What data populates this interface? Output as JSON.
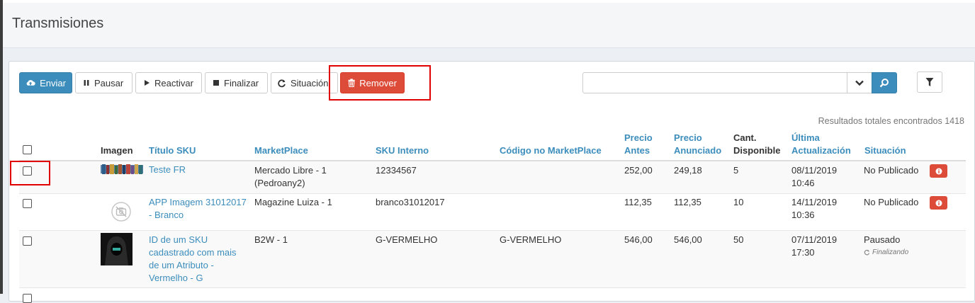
{
  "page": {
    "title": "Transmisiones"
  },
  "toolbar": {
    "enviar": "Enviar",
    "pausar": "Pausar",
    "reactivar": "Reactivar",
    "finalizar": "Finalizar",
    "situacion": "Situación",
    "remover": "Remover"
  },
  "search": {
    "value": "",
    "placeholder": ""
  },
  "results": {
    "text": "Resultados totales encontrados 1418"
  },
  "columns": {
    "imagen": "Imagen",
    "titulo": "Título SKU",
    "marketplace": "MarketPlace",
    "sku_interno": "SKU Interno",
    "codigo": "Código no MarketPlace",
    "precio_antes": [
      "Precio",
      "Antes"
    ],
    "precio_anunciado": [
      "Precio",
      "Anunciado"
    ],
    "cant": [
      "Cant.",
      "Disponible"
    ],
    "ultima": [
      "Última",
      "Actualización"
    ],
    "situacion": "Situación"
  },
  "rows": [
    {
      "titulo": [
        "Teste FR"
      ],
      "marketplace": [
        "Mercado Libre - 1",
        "(Pedroany2)"
      ],
      "sku_interno": "12334567",
      "codigo": "",
      "precio_antes": "252,00",
      "precio_anunciado": "249,18",
      "cant": "5",
      "ultima": [
        "08/11/2019",
        "10:46"
      ],
      "situacion": "No Publicado",
      "sub_status": ""
    },
    {
      "titulo": [
        "APP Imagem 31012017",
        "- Branco"
      ],
      "marketplace": [
        "Magazine Luiza - 1"
      ],
      "sku_interno": "branco31012017",
      "codigo": "",
      "precio_antes": "112,35",
      "precio_anunciado": "112,35",
      "cant": "10",
      "ultima": [
        "14/11/2019",
        "10:36"
      ],
      "situacion": "No Publicado",
      "sub_status": ""
    },
    {
      "titulo": [
        "ID de um SKU",
        "cadastrado com mais",
        "de um Atributo -",
        "Vermelho - G"
      ],
      "marketplace": [
        "B2W - 1"
      ],
      "sku_interno": "G-VERMELHO",
      "codigo": "G-VERMELHO",
      "precio_antes": "546,00",
      "precio_anunciado": "546,00",
      "cant": "50",
      "ultima": [
        "07/11/2019",
        "17:30"
      ],
      "situacion": "Pausado",
      "sub_status": "Finalizando"
    }
  ],
  "colors": {
    "accent": "#3c8dbc",
    "danger": "#dd4b39",
    "highlight": "#e00000"
  }
}
